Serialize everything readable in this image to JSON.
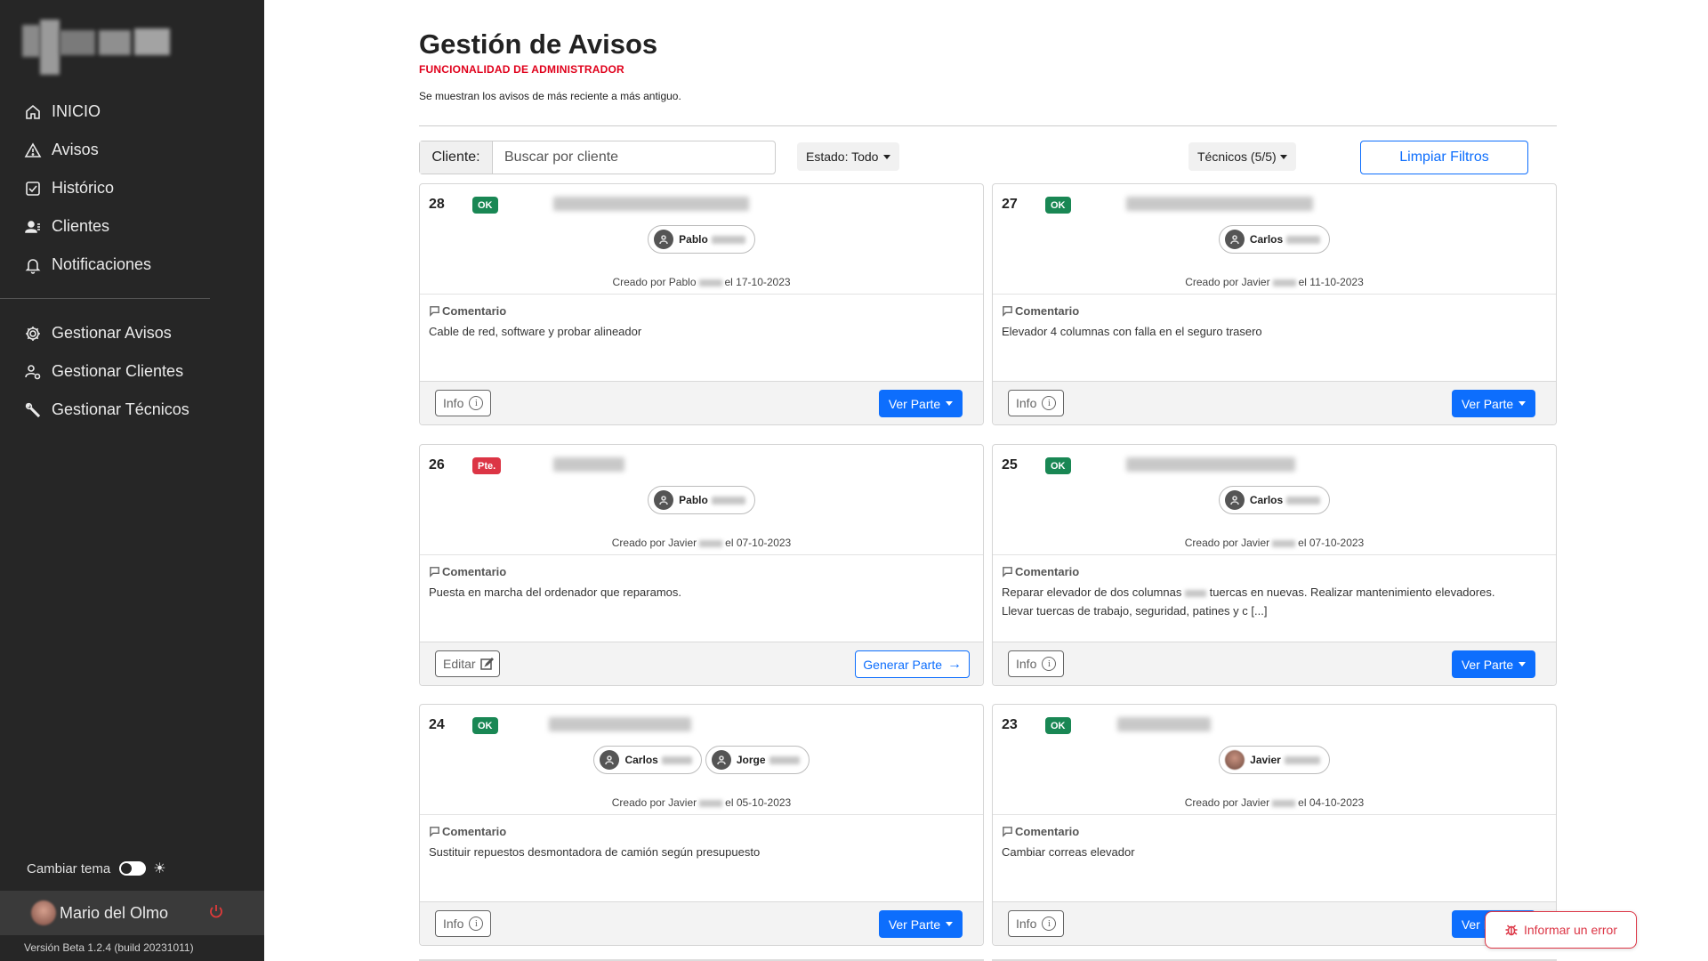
{
  "sidebar": {
    "nav": [
      {
        "label": "INICIO",
        "icon": "home-icon"
      },
      {
        "label": "Avisos",
        "icon": "warning-icon"
      },
      {
        "label": "Histórico",
        "icon": "history-icon"
      },
      {
        "label": "Clientes",
        "icon": "clients-icon"
      },
      {
        "label": "Notificaciones",
        "icon": "bell-icon"
      }
    ],
    "admin_nav": [
      {
        "label": "Gestionar Avisos",
        "icon": "gear-icon"
      },
      {
        "label": "Gestionar Clientes",
        "icon": "user-gear-icon"
      },
      {
        "label": "Gestionar Técnicos",
        "icon": "wrench-icon"
      }
    ],
    "theme_label": "Cambiar tema",
    "user_name": "Mario del Olmo",
    "version": "Versión Beta 1.2.4 (build 20231011)"
  },
  "header": {
    "title": "Gestión de Avisos",
    "subtitle": "FUNCIONALIDAD DE ADMINISTRADOR",
    "description": "Se muestran los avisos de más reciente a más antiguo."
  },
  "filters": {
    "client_label": "Cliente:",
    "client_placeholder": "Buscar por cliente",
    "status": "Estado: Todo",
    "techs": "Técnicos (5/5)",
    "clear": "Limpiar Filtros"
  },
  "card_labels": {
    "comment_title": "Comentario",
    "info": "Info",
    "ver_parte": "Ver Parte",
    "editar": "Editar",
    "generar_parte": "Generar Parte"
  },
  "cards": [
    {
      "num": "28",
      "status": "OK",
      "techs": [
        "Pablo"
      ],
      "created_by": "Creado por Pablo",
      "date": "el 17-10-2023",
      "comment": "Cable de red, software y probar alineador"
    },
    {
      "num": "27",
      "status": "OK",
      "techs": [
        "Carlos"
      ],
      "created_by": "Creado por Javier",
      "date": "el 11-10-2023",
      "comment": "Elevador 4 columnas con falla en el seguro trasero"
    },
    {
      "num": "26",
      "status": "Pte.",
      "techs": [
        "Pablo"
      ],
      "created_by": "Creado por Javier",
      "date": "el 07-10-2023",
      "comment": "Puesta en marcha del ordenador que reparamos."
    },
    {
      "num": "25",
      "status": "OK",
      "techs": [
        "Carlos"
      ],
      "created_by": "Creado por Javier",
      "date": "el 07-10-2023",
      "comment_a": "Reparar elevador de dos columnas",
      "comment_b": "tuercas en nuevas. Realizar mantenimiento elevadores. Llevar tuercas de trabajo, seguridad, patines y c [...]"
    },
    {
      "num": "24",
      "status": "OK",
      "techs": [
        "Carlos",
        "Jorge"
      ],
      "created_by": "Creado por Javier",
      "date": "el 05-10-2023",
      "comment": "Sustituir repuestos desmontadora de camión según presupuesto"
    },
    {
      "num": "23",
      "status": "OK",
      "techs": [
        "Javier"
      ],
      "created_by": "Creado por Javier",
      "date": "el 04-10-2023",
      "comment": "Cambiar correas elevador"
    }
  ],
  "report_error": "Informar un error",
  "colors": {
    "ok": "#198754",
    "pending": "#dc3545",
    "primary": "#0d6efd",
    "sidebar": "#262626",
    "admin": "#e0001b"
  }
}
